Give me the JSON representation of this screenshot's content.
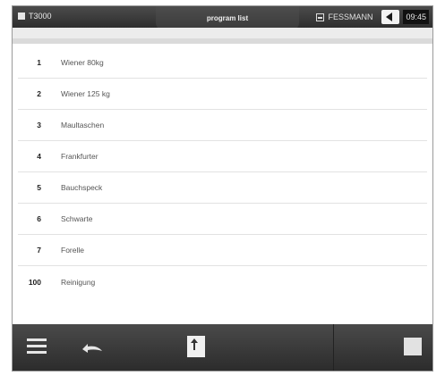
{
  "statusbar": {
    "device": "T3000",
    "title": "program list",
    "brand": "FESSMANN",
    "time": "09:45"
  },
  "programs": [
    {
      "num": "1",
      "name": "Wiener 80kg"
    },
    {
      "num": "2",
      "name": "Wiener 125 kg"
    },
    {
      "num": "3",
      "name": "Maultaschen"
    },
    {
      "num": "4",
      "name": "Frankfurter"
    },
    {
      "num": "5",
      "name": "Bauchspeck"
    },
    {
      "num": "6",
      "name": "Schwarte"
    },
    {
      "num": "7",
      "name": "Forelle"
    },
    {
      "num": "100",
      "name": "Reinigung"
    }
  ],
  "icons": {
    "menu": "menu-icon",
    "undo": "undo-icon",
    "export": "export-icon",
    "stop": "stop-icon",
    "back": "back-icon"
  },
  "colors": {
    "bar": "#3a3a3a",
    "list_bg": "#ffffff",
    "divider": "#e2e2e2"
  }
}
